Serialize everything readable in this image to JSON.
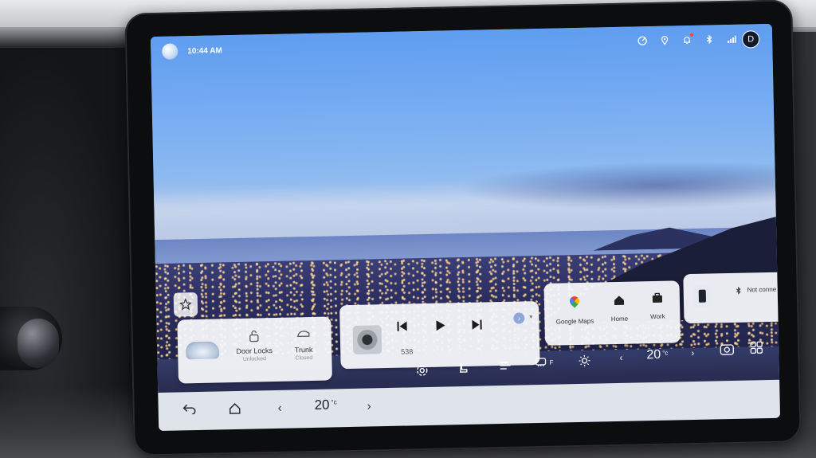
{
  "status_bar": {
    "time": "10:44 AM",
    "avatar_initial": "D"
  },
  "vehicle_card": {
    "door_locks_label": "Door Locks",
    "door_locks_status": "Unlocked",
    "trunk_label": "Trunk",
    "trunk_status": "Closed"
  },
  "media_card": {
    "track": "538"
  },
  "nav_card": {
    "items": [
      {
        "label": "Google Maps"
      },
      {
        "label": "Home"
      },
      {
        "label": "Work"
      }
    ]
  },
  "phone_card": {
    "status": "Not conne"
  },
  "climate": {
    "right_temp": "20",
    "unit": "°c",
    "fan_level": "F"
  },
  "dock": {
    "left_temp": "20",
    "unit": "°c"
  },
  "colors": {
    "dock_bg": "#dfe3ea",
    "card_bg": "#f5f7fa",
    "notification_dot": "#ff4040"
  }
}
